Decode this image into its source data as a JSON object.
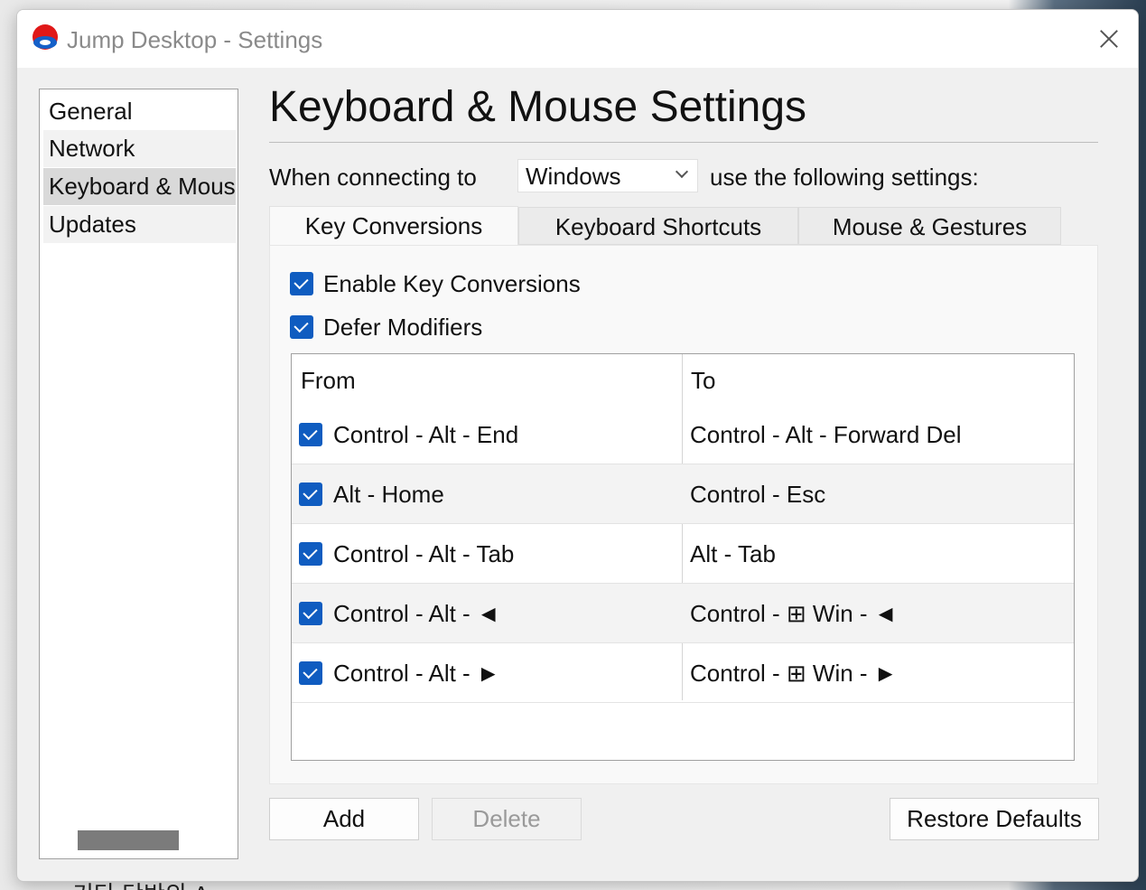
{
  "background": {
    "text": "키타 단반의 A"
  },
  "window": {
    "title": "Jump Desktop - Settings",
    "app_icon": "jump-desktop-logo-icon",
    "close_icon": "close-icon"
  },
  "sidebar": {
    "items": [
      {
        "label": "General",
        "selected": false
      },
      {
        "label": "Network",
        "selected": false
      },
      {
        "label": "Keyboard & Mouse",
        "selected": true
      },
      {
        "label": "Updates",
        "selected": false
      }
    ]
  },
  "main": {
    "title": "Keyboard & Mouse Settings",
    "connecting_label": "When connecting to",
    "os_select_value": "Windows",
    "connecting_suffix": "use the following settings:"
  },
  "tabs": [
    {
      "label": "Key Conversions",
      "active": true
    },
    {
      "label": "Keyboard Shortcuts",
      "active": false
    },
    {
      "label": "Mouse & Gestures",
      "active": false
    }
  ],
  "key_conversions": {
    "enable_label": "Enable Key Conversions",
    "enable_checked": true,
    "defer_label": "Defer Modifiers",
    "defer_checked": true,
    "table": {
      "headers": {
        "from": "From",
        "to": "To"
      },
      "rows": [
        {
          "checked": true,
          "from": "Control - Alt - End",
          "to": "Control - Alt - Forward Del"
        },
        {
          "checked": true,
          "from": "Alt - Home",
          "to": "Control - Esc"
        },
        {
          "checked": true,
          "from": "Control - Alt - Tab",
          "to": "Alt - Tab"
        },
        {
          "checked": true,
          "from": "Control - Alt - ◄",
          "to": "Control - ⊞ Win - ◄"
        },
        {
          "checked": true,
          "from": "Control - Alt - ►",
          "to": "Control - ⊞ Win - ►"
        }
      ]
    }
  },
  "buttons": {
    "add": "Add",
    "delete": "Delete",
    "restore": "Restore Defaults"
  },
  "colors": {
    "accent": "#0f5cc0",
    "selected_nav": "#d9d9d9"
  }
}
